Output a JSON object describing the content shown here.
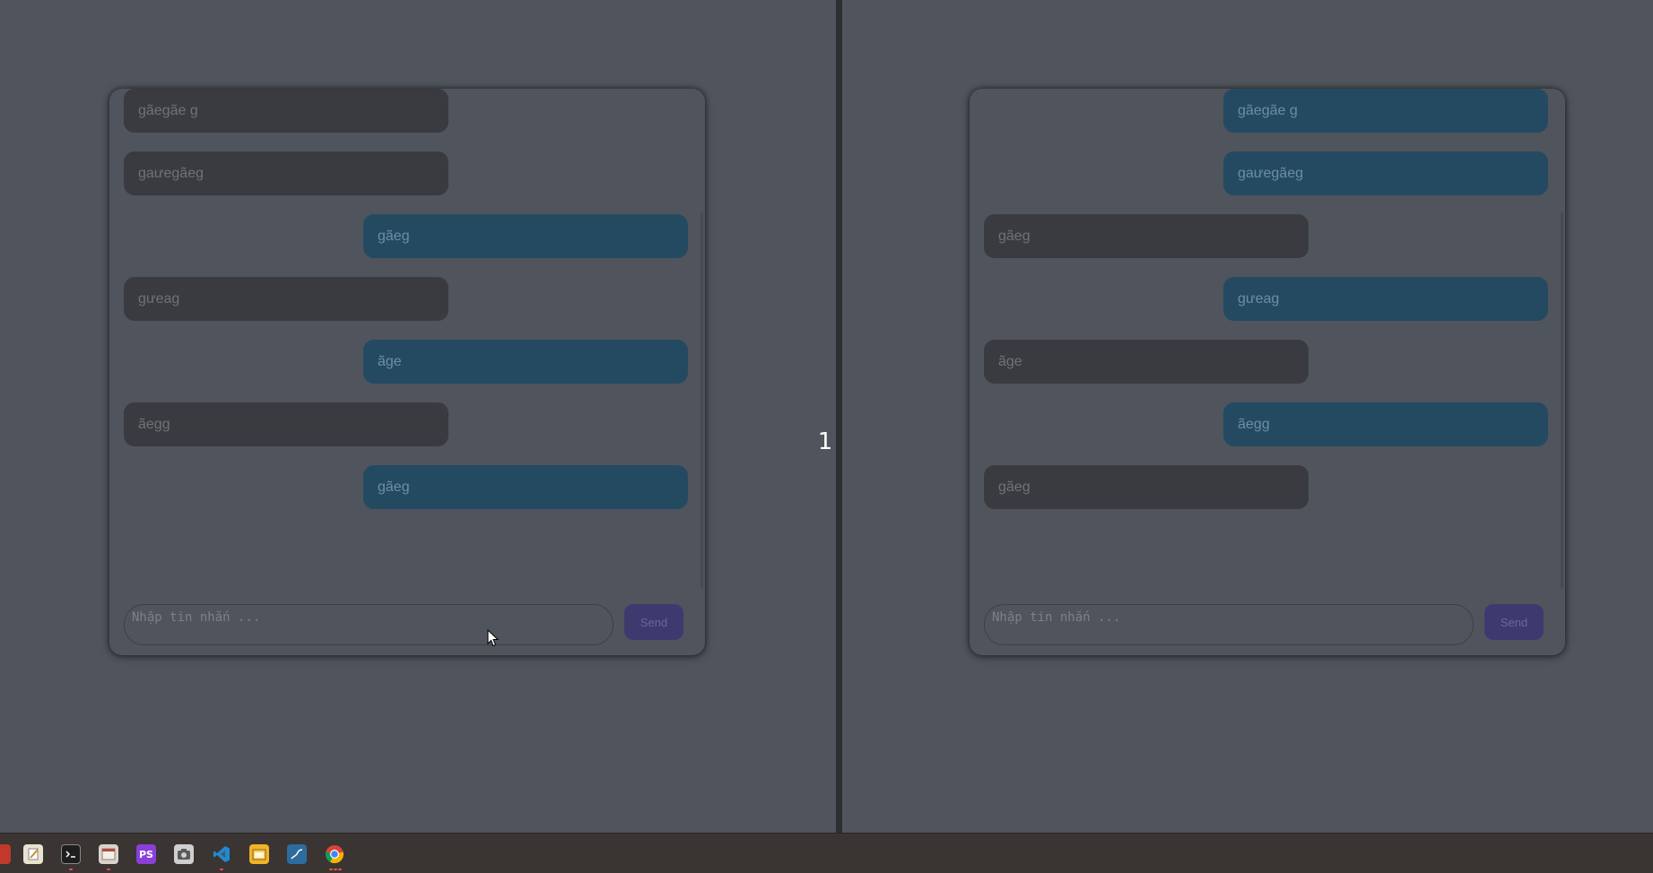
{
  "counter": "1",
  "left_chat": {
    "messages": [
      {
        "text": "gãegãe g",
        "type": "received"
      },
      {
        "text": "gaưegãeg",
        "type": "received"
      },
      {
        "text": "gãeg",
        "type": "sent"
      },
      {
        "text": "gưeag",
        "type": "received"
      },
      {
        "text": "ãge",
        "type": "sent"
      },
      {
        "text": "ãegg",
        "type": "received"
      },
      {
        "text": "gãeg",
        "type": "sent"
      }
    ],
    "input_placeholder": "Nhập tin nhắn ...",
    "send_label": "Send"
  },
  "right_chat": {
    "messages": [
      {
        "text": "gãegãe g",
        "type": "sent"
      },
      {
        "text": "gaưegãeg",
        "type": "sent"
      },
      {
        "text": "gãeg",
        "type": "received"
      },
      {
        "text": "gưeag",
        "type": "sent"
      },
      {
        "text": "ãge",
        "type": "received"
      },
      {
        "text": "ãegg",
        "type": "sent"
      },
      {
        "text": "gãeg",
        "type": "received"
      }
    ],
    "input_placeholder": "Nhập tin nhắn ...",
    "send_label": "Send"
  },
  "taskbar": {
    "icons": [
      {
        "name": "app-red-icon",
        "color": "#c0392b"
      },
      {
        "name": "text-editor-icon",
        "color": "#e8e2d0"
      },
      {
        "name": "terminal-icon",
        "color": "#1e1e1e"
      },
      {
        "name": "file-manager-icon",
        "color": "#d9d4cc"
      },
      {
        "name": "phpstorm-icon",
        "color": "#8b3fd9",
        "glyph": "PS"
      },
      {
        "name": "camera-icon",
        "color": "#cfcfcf"
      },
      {
        "name": "vscode-icon",
        "color": "#1f8ad2"
      },
      {
        "name": "folder-icon",
        "color": "#f0b429"
      },
      {
        "name": "database-icon",
        "color": "#2e6b9e"
      },
      {
        "name": "chrome-icon",
        "color": "#e04a3c"
      }
    ]
  },
  "colors": {
    "background": "#50545c",
    "received_bubble": "#393b40",
    "sent_bubble": "#244a62",
    "send_button": "#3d3a70",
    "divider": "#2c2e32",
    "taskbar": "#3a3533"
  }
}
